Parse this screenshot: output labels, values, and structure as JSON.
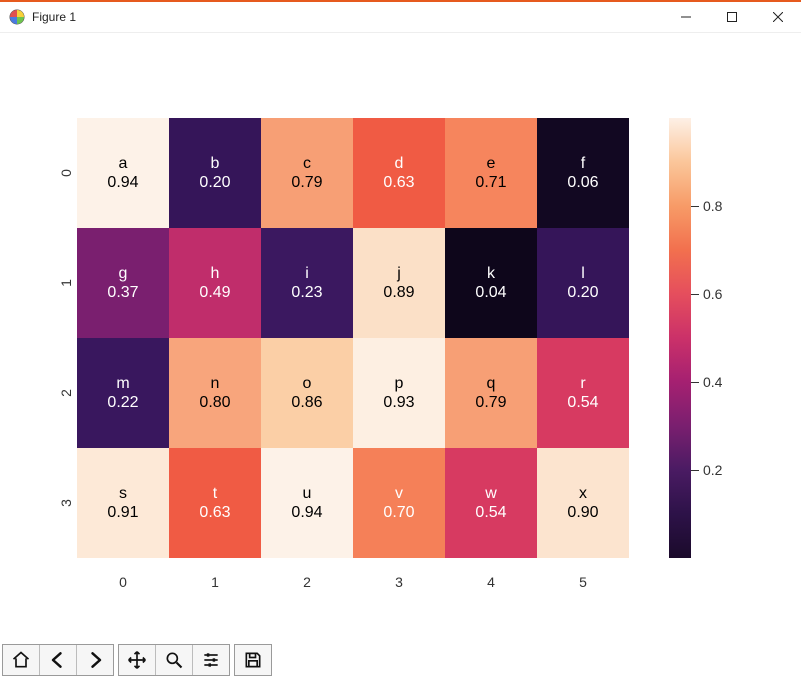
{
  "window": {
    "title": "Figure 1"
  },
  "toolbar": {
    "home": "home",
    "back": "back",
    "forward": "forward",
    "pan": "pan",
    "zoom": "zoom",
    "configure": "configure",
    "save": "save"
  },
  "chart_data": {
    "type": "heatmap",
    "x_categories": [
      "0",
      "1",
      "2",
      "3",
      "4",
      "5"
    ],
    "y_categories": [
      "0",
      "1",
      "2",
      "3"
    ],
    "colorbar_ticks": [
      "0.2",
      "0.4",
      "0.6",
      "0.8"
    ],
    "colormap": "magma_r",
    "cells": [
      [
        {
          "label": "a",
          "value": "0.94",
          "num": 0.94,
          "bg": "#fdf2e8",
          "fg": "#000000"
        },
        {
          "label": "b",
          "value": "0.20",
          "num": 0.2,
          "bg": "#351559",
          "fg": "#ffffff"
        },
        {
          "label": "c",
          "value": "0.79",
          "num": 0.79,
          "bg": "#f79f75",
          "fg": "#000000"
        },
        {
          "label": "d",
          "value": "0.63",
          "num": 0.63,
          "bg": "#f05b44",
          "fg": "#ffffff"
        },
        {
          "label": "e",
          "value": "0.71",
          "num": 0.71,
          "bg": "#f6855d",
          "fg": "#000000"
        },
        {
          "label": "f",
          "value": "0.06",
          "num": 0.06,
          "bg": "#120822",
          "fg": "#ffffff"
        }
      ],
      [
        {
          "label": "g",
          "value": "0.37",
          "num": 0.37,
          "bg": "#7a1f6f",
          "fg": "#ffffff"
        },
        {
          "label": "h",
          "value": "0.49",
          "num": 0.49,
          "bg": "#c02d6b",
          "fg": "#ffffff"
        },
        {
          "label": "i",
          "value": "0.23",
          "num": 0.23,
          "bg": "#3b1860",
          "fg": "#ffffff"
        },
        {
          "label": "j",
          "value": "0.89",
          "num": 0.89,
          "bg": "#fbe0c7",
          "fg": "#000000"
        },
        {
          "label": "k",
          "value": "0.04",
          "num": 0.04,
          "bg": "#0e061b",
          "fg": "#ffffff"
        },
        {
          "label": "l",
          "value": "0.20",
          "num": 0.2,
          "bg": "#351559",
          "fg": "#ffffff"
        }
      ],
      [
        {
          "label": "m",
          "value": "0.22",
          "num": 0.22,
          "bg": "#39175e",
          "fg": "#ffffff"
        },
        {
          "label": "n",
          "value": "0.80",
          "num": 0.8,
          "bg": "#f8a57c",
          "fg": "#000000"
        },
        {
          "label": "o",
          "value": "0.86",
          "num": 0.86,
          "bg": "#fbcfa6",
          "fg": "#000000"
        },
        {
          "label": "p",
          "value": "0.93",
          "num": 0.93,
          "bg": "#fdefe2",
          "fg": "#000000"
        },
        {
          "label": "q",
          "value": "0.79",
          "num": 0.79,
          "bg": "#f79f75",
          "fg": "#000000"
        },
        {
          "label": "r",
          "value": "0.54",
          "num": 0.54,
          "bg": "#d73a61",
          "fg": "#ffffff"
        }
      ],
      [
        {
          "label": "s",
          "value": "0.91",
          "num": 0.91,
          "bg": "#fde9d7",
          "fg": "#000000"
        },
        {
          "label": "t",
          "value": "0.63",
          "num": 0.63,
          "bg": "#f05b44",
          "fg": "#ffffff"
        },
        {
          "label": "u",
          "value": "0.94",
          "num": 0.94,
          "bg": "#fdf2e8",
          "fg": "#000000"
        },
        {
          "label": "v",
          "value": "0.70",
          "num": 0.7,
          "bg": "#f58058",
          "fg": "#ffffff"
        },
        {
          "label": "w",
          "value": "0.54",
          "num": 0.54,
          "bg": "#d73a61",
          "fg": "#ffffff"
        },
        {
          "label": "x",
          "value": "0.90",
          "num": 0.9,
          "bg": "#fce4cf",
          "fg": "#000000"
        }
      ]
    ]
  }
}
